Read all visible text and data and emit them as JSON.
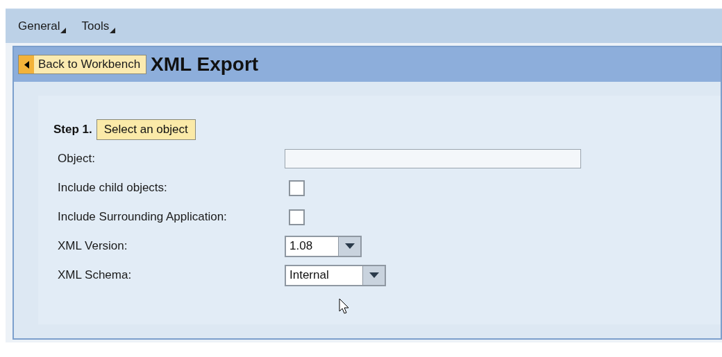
{
  "menu": [
    {
      "label": "General"
    },
    {
      "label": "Tools"
    }
  ],
  "back_button": "Back to Workbench",
  "title": "XML Export",
  "step": {
    "label": "Step 1.",
    "button": "Select an object"
  },
  "fields": [
    {
      "kind": "text",
      "label": "Object:"
    },
    {
      "kind": "checkbox",
      "label": "Include child objects:",
      "checked": false
    },
    {
      "kind": "checkbox",
      "label": "Include Surrounding Application:",
      "checked": false
    },
    {
      "kind": "dropdown",
      "label": "XML Version:",
      "value": "1.08"
    },
    {
      "kind": "dropdown",
      "label": "XML Schema:",
      "value": "Internal"
    }
  ]
}
